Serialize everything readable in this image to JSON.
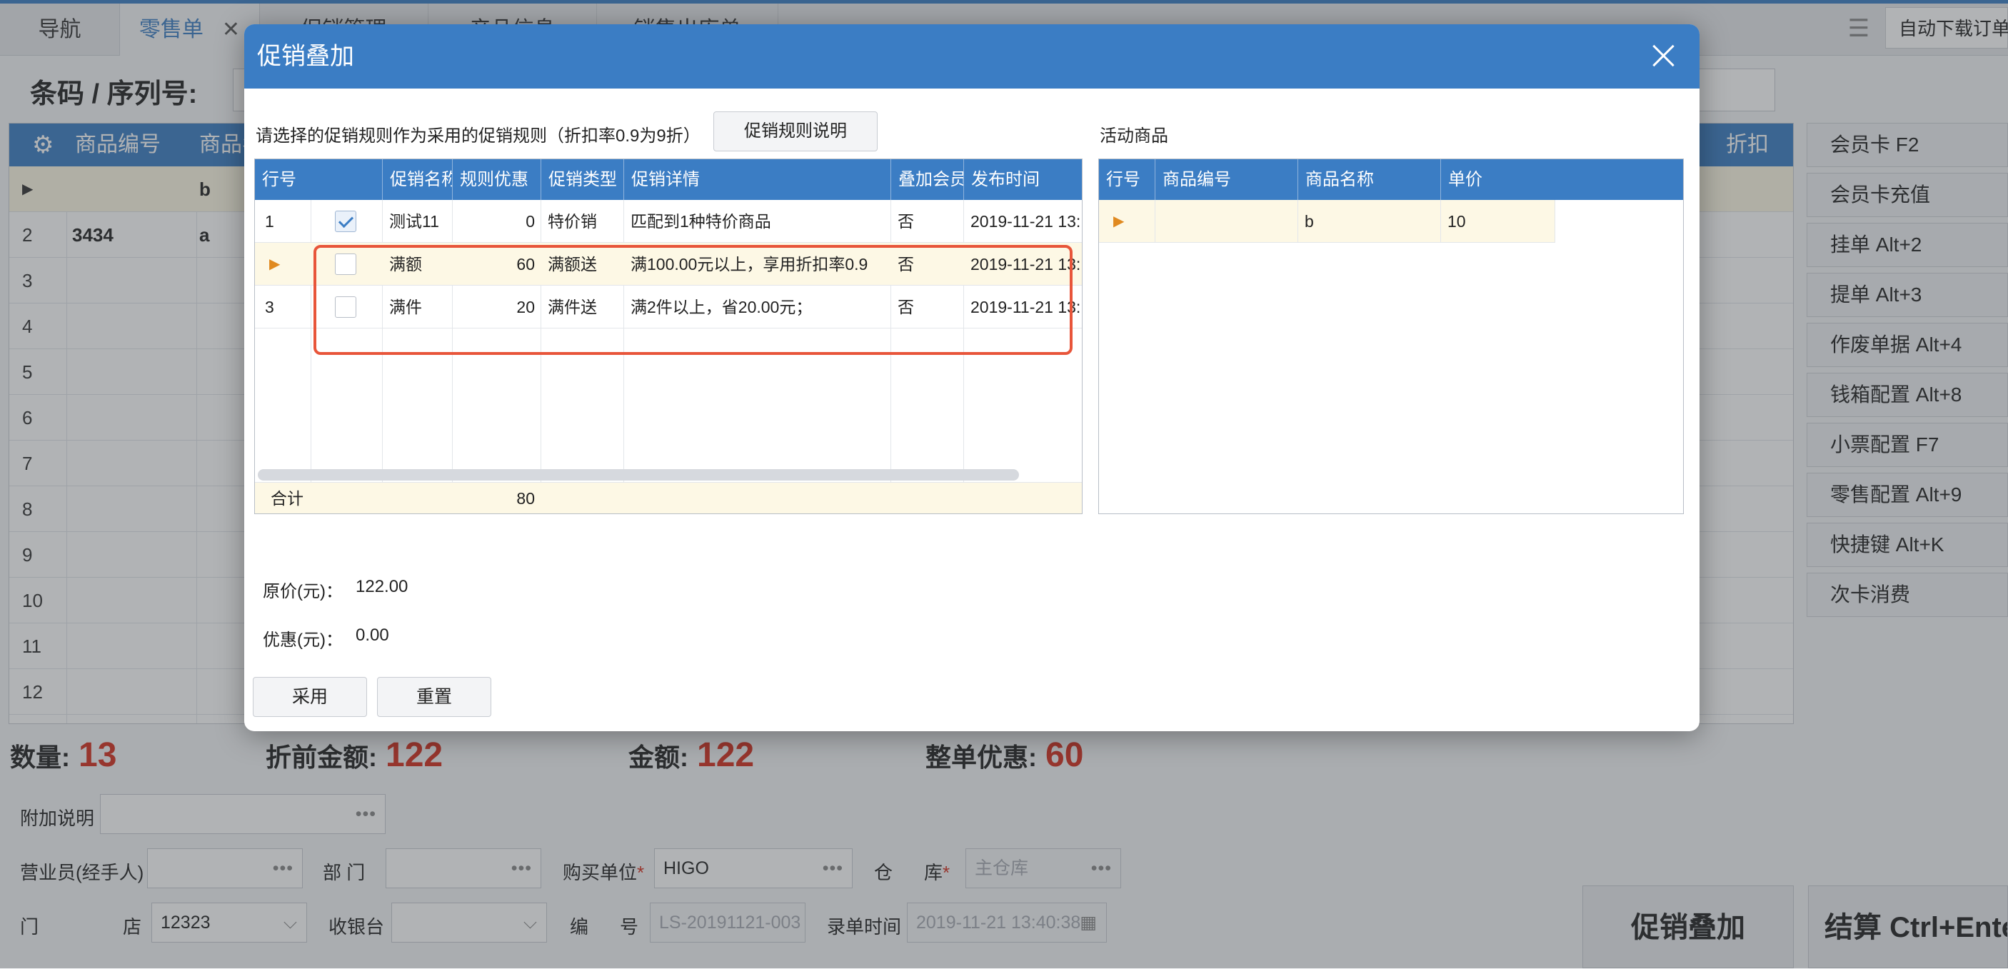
{
  "tabs": [
    {
      "label": "导航"
    },
    {
      "label": "零售单"
    },
    {
      "label": "促销管理"
    },
    {
      "label": "产品信息"
    },
    {
      "label": "销售出库单"
    }
  ],
  "autodl_label": "自动下载订单",
  "barcode_label": "条码 / 序列号:",
  "main_grid": {
    "headers": [
      "商品编号",
      "商品名",
      "折扣"
    ],
    "rows": [
      {
        "num": "",
        "code": "",
        "name": "b"
      },
      {
        "num": "2",
        "code": "3434",
        "name": "a"
      },
      {
        "num": "3"
      },
      {
        "num": "4"
      },
      {
        "num": "5"
      },
      {
        "num": "6"
      },
      {
        "num": "7"
      },
      {
        "num": "8"
      },
      {
        "num": "9"
      },
      {
        "num": "10"
      },
      {
        "num": "11"
      },
      {
        "num": "12"
      }
    ]
  },
  "side_buttons": [
    "会员卡 F2",
    "会员卡充值",
    "挂单 Alt+2",
    "提单 Alt+3",
    "作废单据 Alt+4",
    "钱箱配置 Alt+8",
    "小票配置 F7",
    "零售配置 Alt+9",
    "快捷键 Alt+K",
    "次卡消费"
  ],
  "stats": {
    "qty_label": "数量:",
    "qty": "13",
    "pre_label": "折前金额:",
    "pre": "122",
    "amt_label": "金额:",
    "amt": "122",
    "disc_label": "整单优惠:",
    "disc": "60"
  },
  "form": {
    "note_label": "附加说明",
    "sales_label": "营业员(经手人)",
    "dept_label": "部 门",
    "buyer_label": "购买单位",
    "buyer_value": "HIGO",
    "wh_label1": "仓",
    "wh_label2": "库",
    "wh_value": "主仓库",
    "store_label1": "门",
    "store_label2": "店",
    "store_value": "12323",
    "cashier_label": "收银台",
    "no_label1": "编",
    "no_label2": "号",
    "no_value": "LS-20191121-003",
    "time_label": "录单时间",
    "time_value": "2019-11-21 13:40:38",
    "required_mark": "*"
  },
  "buttons": {
    "promo_stack": "促销叠加",
    "checkout": "结算 Ctrl+Enter"
  },
  "modal": {
    "title": "促销叠加",
    "hint": "请选择的促销规则作为采用的促销规则（折扣率0.9为9折）",
    "explain_btn": "促销规则说明",
    "right_title": "活动商品",
    "rules_headers": [
      "行号",
      "",
      "促销名称",
      "规则优惠",
      "促销类型",
      "促销详情",
      "叠加会员",
      "发布时间"
    ],
    "rules": [
      {
        "row": "1",
        "checked": true,
        "name": "测试11",
        "discount": "0",
        "type": "特价销",
        "detail": "匹配到1种特价商品",
        "member": "否",
        "time": "2019-11-21 13:"
      },
      {
        "row": "",
        "checked": false,
        "name": "满额",
        "discount": "60",
        "type": "满额送",
        "detail": "满100.00元以上，享用折扣率0.9",
        "member": "否",
        "time": "2019-11-21 13:"
      },
      {
        "row": "3",
        "checked": false,
        "name": "满件",
        "discount": "20",
        "type": "满件送",
        "detail": "满2件以上，省20.00元；",
        "member": "否",
        "time": "2019-11-21 13:"
      }
    ],
    "total_label": "合计",
    "total_value": "80",
    "goods_headers": [
      "行号",
      "商品编号",
      "商品名称",
      "单价"
    ],
    "goods": [
      {
        "row": "",
        "code": "",
        "name": "b",
        "price": "10"
      }
    ],
    "orig_label": "原价(元)：",
    "orig_value": "122.00",
    "disc_label": "优惠(元)：",
    "disc_value": "0.00",
    "apply_btn": "采用",
    "reset_btn": "重置"
  },
  "icons": {
    "settings": "gear-icon",
    "close": "close-icon",
    "current_row": "row-pointer-icon",
    "calendar": "calendar-icon",
    "dropdown": "chevron-down-icon",
    "more": "ellipsis-icon"
  },
  "colors": {
    "header_blue": "#3b7dc4",
    "highlight_red": "#e8553a",
    "stat_red": "#d4301f",
    "selected_row": "#fdf8e5"
  }
}
